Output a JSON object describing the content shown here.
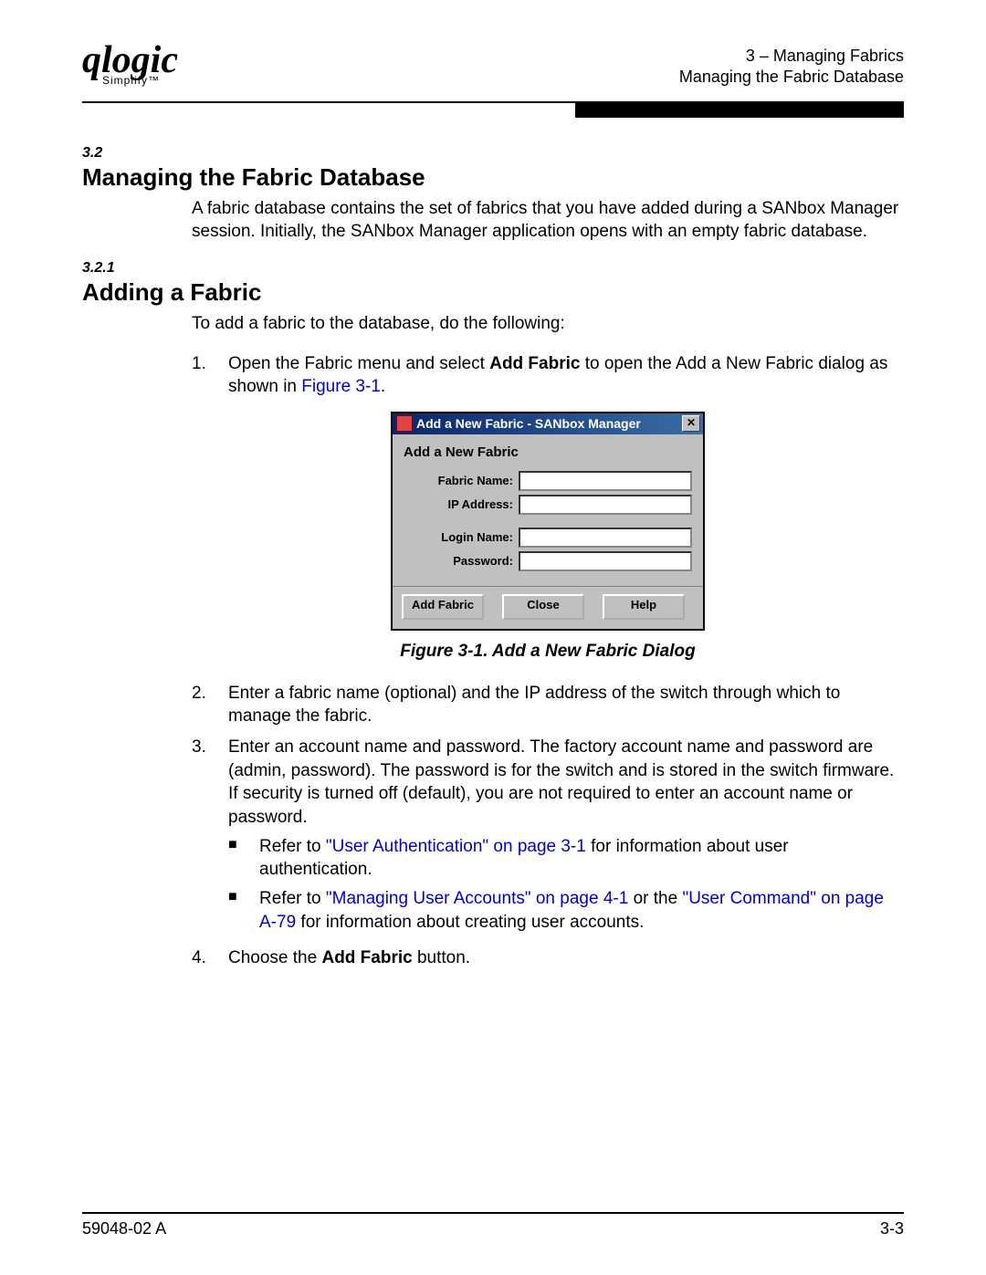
{
  "header": {
    "logo_main": "qlogic",
    "logo_sub": "Simplify™",
    "line1": "3 – Managing Fabrics",
    "line2": "Managing the Fabric Database"
  },
  "section1": {
    "num": "3.2",
    "title": "Managing the Fabric Database",
    "body": "A fabric database contains the set of fabrics that you have added during a SANbox Manager session. Initially, the SANbox Manager application opens with an empty fabric database."
  },
  "section2": {
    "num": "3.2.1",
    "title": "Adding a Fabric",
    "intro": "To add a fabric to the database, do the following:"
  },
  "steps": {
    "s1_num": "1.",
    "s1_a": "Open the Fabric menu and select ",
    "s1_bold": "Add Fabric",
    "s1_b": " to open the Add a New Fabric dialog as shown in ",
    "s1_link": "Figure 3-1",
    "s1_c": ".",
    "s2_num": "2.",
    "s2": "Enter a fabric name (optional) and the IP address of the switch through which to manage the fabric.",
    "s3_num": "3.",
    "s3": "Enter an account name and password. The factory account name and password are (admin, password). The password is for the switch and is stored in the switch firmware. If security is turned off (default), you are not required to enter an account name or password.",
    "b1_a": "Refer to ",
    "b1_link": "\"User Authentication\" on page 3-1",
    "b1_b": " for information about user authentication.",
    "b2_a": "Refer to ",
    "b2_link1": "\"Managing User Accounts\" on page 4-1",
    "b2_mid": " or the ",
    "b2_link2": "\"User Command\" on page A-79",
    "b2_b": " for information about creating user accounts.",
    "s4_num": "4.",
    "s4_a": "Choose the ",
    "s4_bold": "Add Fabric",
    "s4_b": " button."
  },
  "dialog": {
    "title": "Add a New Fabric - SANbox Manager",
    "heading": "Add a New Fabric",
    "label_fabric": "Fabric Name:",
    "label_ip": "IP Address:",
    "label_login": "Login Name:",
    "label_pw": "Password:",
    "btn_add": "Add Fabric",
    "btn_close": "Close",
    "btn_help": "Help"
  },
  "figure_caption": "Figure 3-1.  Add a New Fabric Dialog",
  "footer": {
    "left": "59048-02 A",
    "right": "3-3"
  }
}
